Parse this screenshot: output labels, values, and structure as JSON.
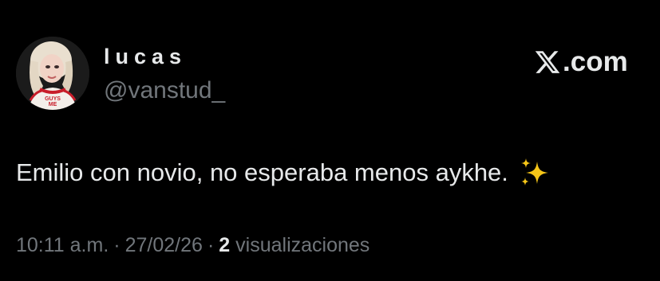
{
  "author": {
    "display_name": "lucas",
    "handle": "@vanstud_",
    "avatar_shirt_text": "GUYS ME"
  },
  "brand": {
    "logo_icon": "x-logo-icon",
    "domain_text": ".com"
  },
  "tweet": {
    "text": "Emilio con novio, no esperaba menos aykhe.",
    "emoji_icon": "sparkles-icon"
  },
  "meta": {
    "time": "10:11 a.m.",
    "separator1": "·",
    "date": "27/02/26",
    "separator2": "·",
    "views_count": "2",
    "views_label": "visualizaciones"
  },
  "colors": {
    "background": "#000000",
    "primary_text": "#e7e9ea",
    "secondary_text": "#71767b",
    "sparkle": "#f5c518"
  }
}
